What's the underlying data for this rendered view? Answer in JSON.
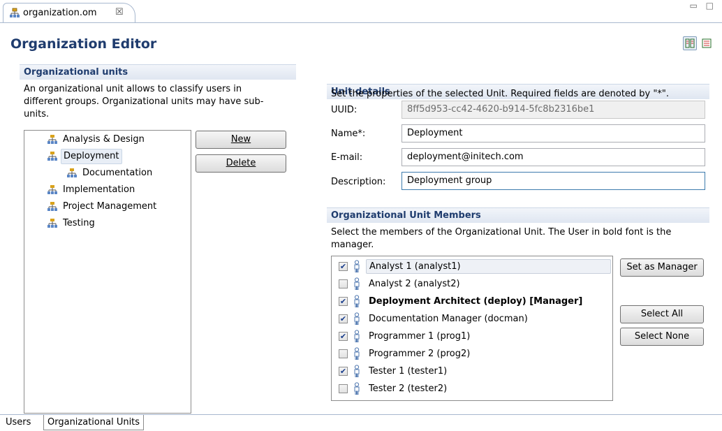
{
  "editor_tab": {
    "label": "organization.om",
    "close": "☒"
  },
  "window_controls": "▭ □",
  "title": "Organization Editor",
  "left": {
    "header": "Organizational units",
    "description": "An organizational unit allows to classify users in different groups. Organizational units may have sub-units.",
    "tree": [
      {
        "label": "Analysis & Design",
        "level": 0
      },
      {
        "label": "Deployment",
        "level": 0,
        "selected": true
      },
      {
        "label": "Documentation",
        "level": 1
      },
      {
        "label": "Implementation",
        "level": 0
      },
      {
        "label": "Project Management",
        "level": 0
      },
      {
        "label": "Testing",
        "level": 0
      }
    ],
    "new_button": "New",
    "delete_button": "Delete"
  },
  "details": {
    "header": "Unit details",
    "description": "Set the properties of the selected Unit. Required fields are denoted by \"*\".",
    "uuid_label": "UUID:",
    "uuid_value": "8ff5d953-cc42-4620-b914-5fc8b2316be1",
    "name_label": "Name*:",
    "name_value": "Deployment",
    "email_label": "E-mail:",
    "email_value": "deployment@initech.com",
    "description_label": "Description:",
    "description_value": "Deployment group"
  },
  "members": {
    "header": "Organizational Unit Members",
    "description": "Select the members of the Organizational Unit. The User in bold font is the manager.",
    "items": [
      {
        "label": "Analyst 1 (analyst1)",
        "checked": true,
        "bold": false,
        "selected": true
      },
      {
        "label": "Analyst 2 (analyst2)",
        "checked": false,
        "bold": false
      },
      {
        "label": "Deployment Architect (deploy) [Manager]",
        "checked": true,
        "bold": true
      },
      {
        "label": "Documentation Manager (docman)",
        "checked": true,
        "bold": false
      },
      {
        "label": "Programmer 1 (prog1)",
        "checked": true,
        "bold": false
      },
      {
        "label": "Programmer 2 (prog2)",
        "checked": false,
        "bold": false
      },
      {
        "label": "Tester 1 (tester1)",
        "checked": true,
        "bold": false
      },
      {
        "label": "Tester 2 (tester2)",
        "checked": false,
        "bold": false
      }
    ],
    "set_manager_button": "Set as Manager",
    "select_all_button": "Select All",
    "select_none_button": "Select None"
  },
  "bottom_tabs": [
    "Users",
    "Organizational Units"
  ],
  "colors": {
    "title": "#1f3c6e",
    "accent": "#3d7bad"
  }
}
